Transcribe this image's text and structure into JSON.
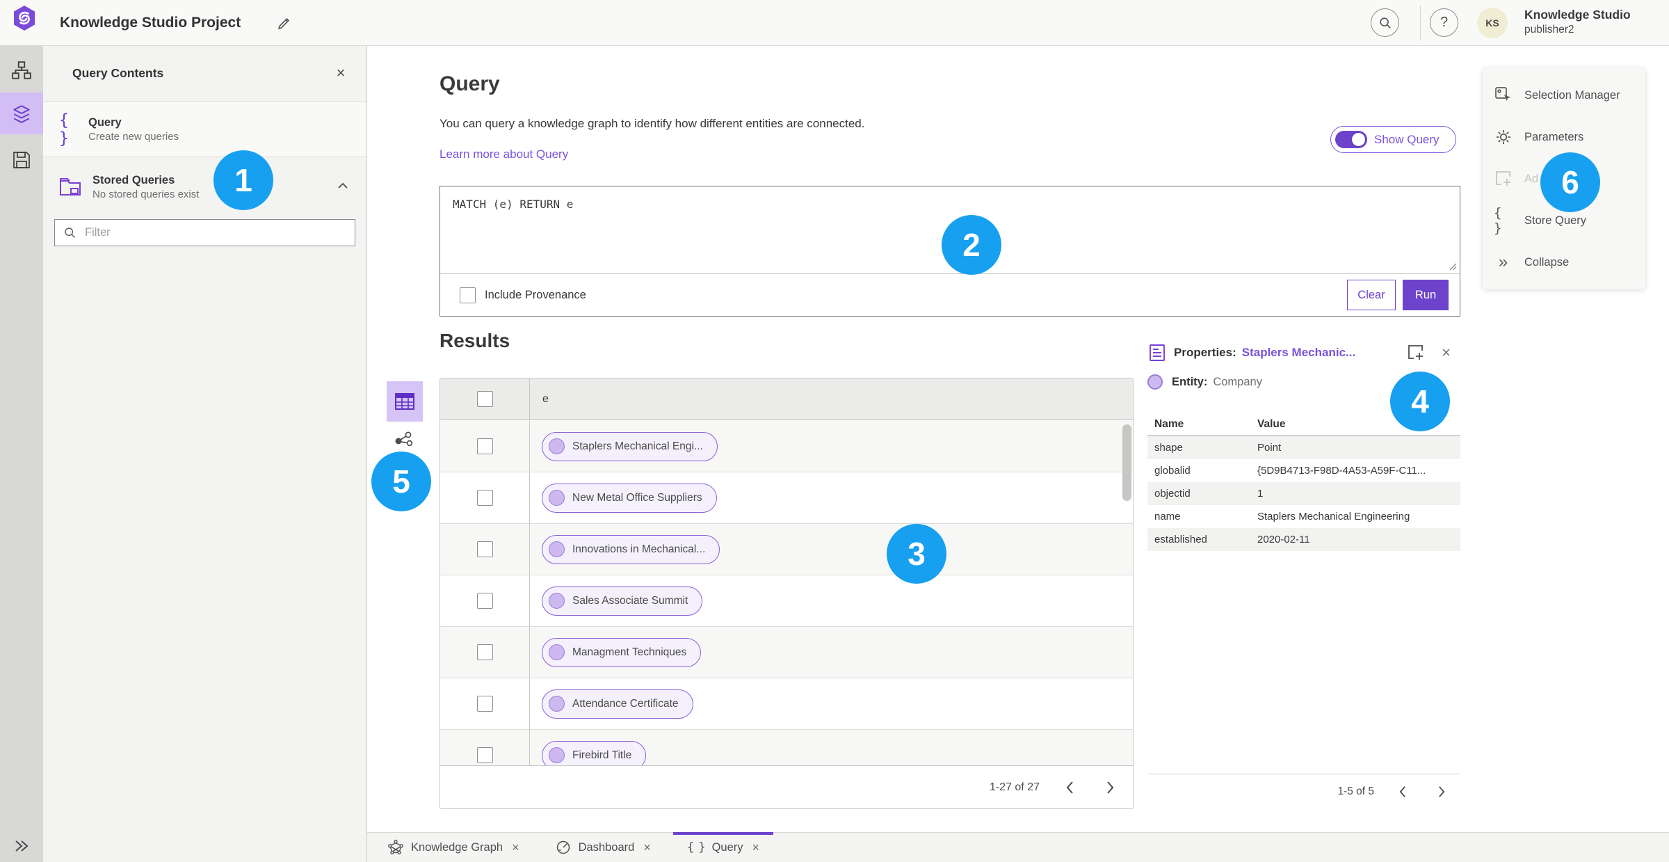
{
  "icons": {
    "close": "×",
    "braces": "{ }",
    "collapse_chevrons": "»",
    "help": "?"
  },
  "topbar": {
    "title": "Knowledge Studio Project",
    "user_name": "Knowledge Studio",
    "user_role": "publisher2",
    "avatar_initials": "KS"
  },
  "contents_panel": {
    "title": "Query Contents",
    "query_item": {
      "label": "Query",
      "sublabel": "Create new queries"
    },
    "stored_item": {
      "label": "Stored Queries",
      "sublabel": "No stored queries exist"
    },
    "filter_placeholder": "Filter"
  },
  "query_section": {
    "heading": "Query",
    "description": "You can query a knowledge graph to identify how different entities are connected.",
    "learn_more": "Learn more about Query",
    "show_query": "Show Query",
    "query_text": "MATCH (e) RETURN e",
    "include_provenance": "Include Provenance",
    "clear": "Clear",
    "run": "Run"
  },
  "results": {
    "heading": "Results",
    "column": "e",
    "rows": [
      "Staplers Mechanical Engi...",
      "New Metal Office Suppliers",
      "Innovations in Mechanical...",
      "Sales Associate Summit",
      "Managment Techniques",
      "Attendance Certificate",
      "Firebird Title"
    ],
    "pagination": "1-27 of 27"
  },
  "properties": {
    "label": "Properties:",
    "entity_link": "Staplers Mechanic...",
    "entity_label": "Entity:",
    "entity_type": "Company",
    "col_name": "Name",
    "col_value": "Value",
    "rows": [
      {
        "name": "shape",
        "value": "Point"
      },
      {
        "name": "globalid",
        "value": "{5D9B4713-F98D-4A53-A59F-C11..."
      },
      {
        "name": "objectid",
        "value": "1"
      },
      {
        "name": "name",
        "value": "Staplers Mechanical Engineering"
      },
      {
        "name": "established",
        "value": "2020-02-11"
      }
    ],
    "pagination": "1-5 of 5"
  },
  "action_panel": {
    "items": [
      {
        "label": "Selection Manager"
      },
      {
        "label": "Parameters"
      },
      {
        "label": "Ad"
      },
      {
        "label": "Store Query"
      },
      {
        "label": "Collapse"
      }
    ]
  },
  "tabs": [
    {
      "label": "Knowledge Graph"
    },
    {
      "label": "Dashboard"
    },
    {
      "label": "Query"
    }
  ],
  "annotations": [
    "1",
    "2",
    "3",
    "4",
    "5",
    "6"
  ],
  "colors": {
    "brand_purple": "#6d43cc",
    "light_purple": "#d6c4f6",
    "link_purple": "#7a52dd",
    "annotation_blue": "#18a0f0",
    "pill_fill": "#f5f1fc",
    "pill_border": "#8a5fd6"
  }
}
